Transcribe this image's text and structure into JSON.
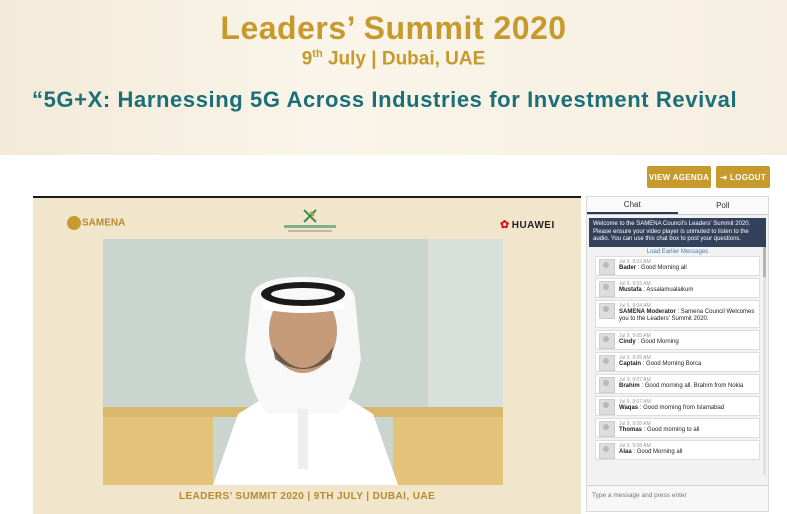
{
  "banner": {
    "title": "Leaders’ Summit 2020",
    "date_day": "9",
    "date_sup": "th",
    "date_rest": " July | Dubai, UAE",
    "subtitle": "“5G+X: Harnessing 5G Across Industries for Investment Revival"
  },
  "actions": {
    "agenda_label": "VIEW AGENDA",
    "logout_label": "LOGOUT"
  },
  "player": {
    "logo_left": "SAMENA",
    "logo_right": "HUAWEI",
    "caption": "LEADERS’ SUMMIT 2020 | 9TH JULY | DUBAI, UAE"
  },
  "chat": {
    "tabs": [
      "Chat",
      "Poll"
    ],
    "welcome": "Welcome to the SAMENA Council's Leaders' Summit 2020. Please ensure your video player is unmuted to listen to the audio. You can use this chat box to post your questions.",
    "load_earlier": "Load Earlier Messages",
    "messages": [
      {
        "time": "Jul 9, 9:03 AM",
        "user": "Bader",
        "text": "Good Morning all"
      },
      {
        "time": "Jul 9, 9:03 AM",
        "user": "Mustafa",
        "text": "Assalamualaikum"
      },
      {
        "time": "Jul 9, 9:04 AM",
        "user": "SAMENA Moderator",
        "text": "Samena Council Welcomes you to the Leaders' Summit 2020."
      },
      {
        "time": "Jul 9, 9:05 AM",
        "user": "Cindy",
        "text": "Good Morning"
      },
      {
        "time": "Jul 9, 9:05 AM",
        "user": "Captain",
        "text": "Good Morning Borca"
      },
      {
        "time": "Jul 9, 9:07 AM",
        "user": "Brahim",
        "text": "Good morning all. Brahim from Nokia"
      },
      {
        "time": "Jul 9, 9:07 AM",
        "user": "Waqas",
        "text": "Good morning from Islamabad"
      },
      {
        "time": "Jul 9, 9:08 AM",
        "user": "Thomas",
        "text": "Good morning to all"
      },
      {
        "time": "Jul 9, 9:08 AM",
        "user": "Alaa",
        "text": "Good Morning all"
      }
    ],
    "input_placeholder": "Type a message and press enter"
  }
}
